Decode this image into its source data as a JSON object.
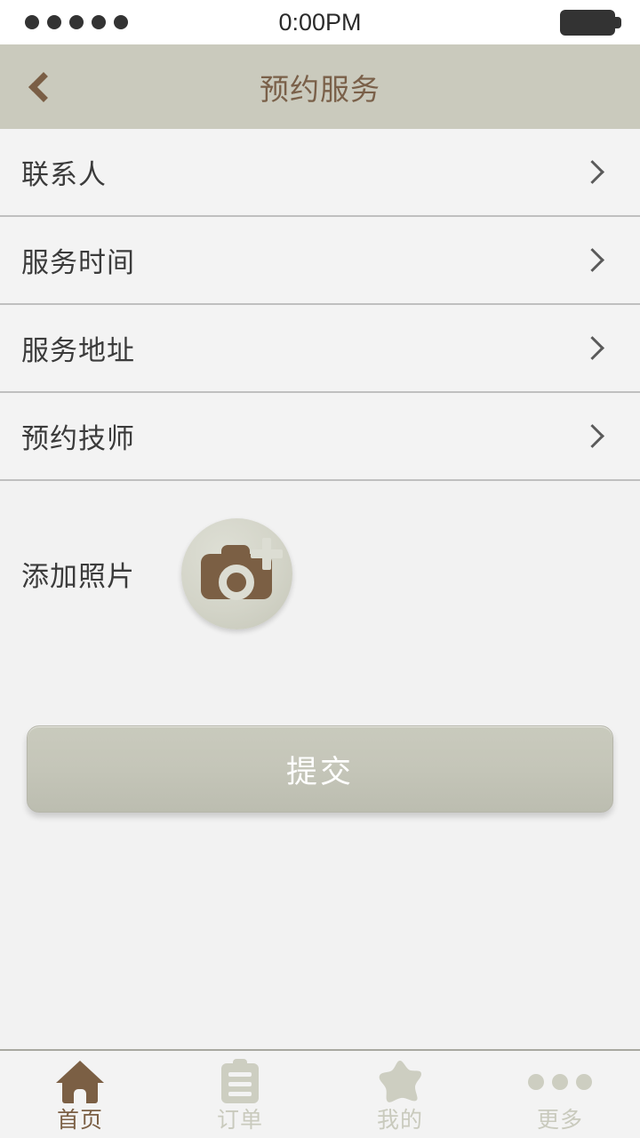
{
  "status_bar": {
    "signal_dots": 5,
    "time": "0:00PM",
    "battery_icon": "battery-full-icon"
  },
  "nav_bar": {
    "back_icon": "chevron-left-icon",
    "title": "预约服务",
    "title_color": "#7a6049",
    "background_color": "#cacabd"
  },
  "main": {
    "rows": [
      {
        "label": "联系人",
        "chevron_icon": "chevron-right-icon"
      },
      {
        "label": "服务时间",
        "chevron_icon": "chevron-right-icon"
      },
      {
        "label": "服务地址",
        "chevron_icon": "chevron-right-icon"
      },
      {
        "label": "预约技师",
        "chevron_icon": "chevron-right-icon"
      }
    ],
    "photo": {
      "label": "添加照片",
      "button_icon": "camera-add-icon"
    },
    "submit": {
      "label": "提交"
    }
  },
  "tab_bar": {
    "tabs": [
      {
        "label": "首页",
        "icon": "home-icon",
        "active": true
      },
      {
        "label": "订单",
        "icon": "clipboard-icon",
        "active": false
      },
      {
        "label": "我的",
        "icon": "star-icon",
        "active": false
      },
      {
        "label": "更多",
        "icon": "more-dots-icon",
        "active": false
      }
    ]
  },
  "colors": {
    "accent_brown": "#7b5f44",
    "bar_beige": "#cacabd",
    "page_background": "#f2f2f2",
    "icon_inactive": "#cdcec1"
  }
}
